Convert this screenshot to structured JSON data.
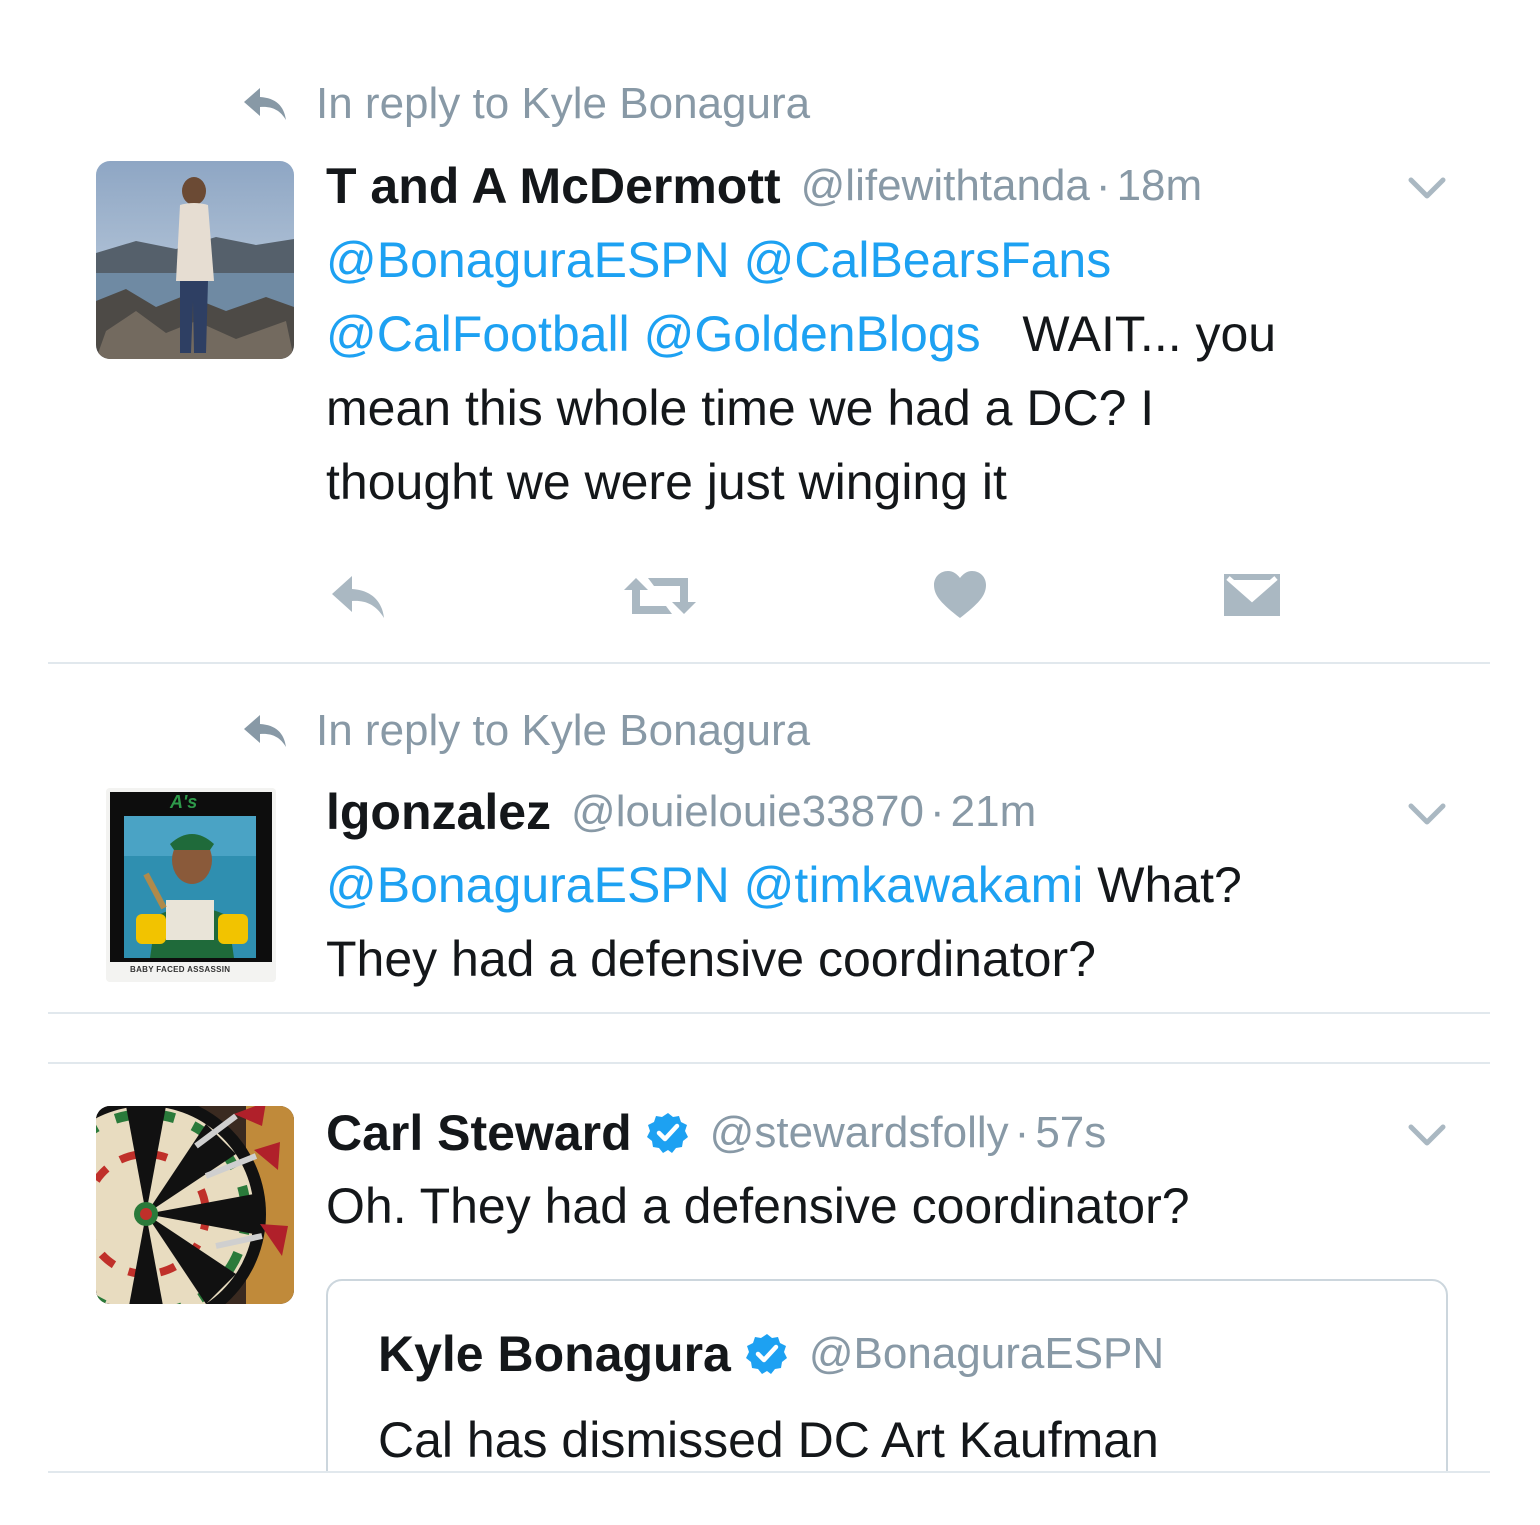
{
  "tweets": [
    {
      "reply_context": "In reply to Kyle Bonagura",
      "name": "T and A McDermott",
      "handle": "@lifewithtanda",
      "separator": "·",
      "time": "18m",
      "mentions": [
        "@BonaguraESPN",
        "@CalBearsFans",
        "@CalFootball",
        "@GoldenBlogs"
      ],
      "text_after_mentions": "WAIT... you",
      "text_lines": [
        "mean this whole time we had a DC? I",
        "thought we were just winging it"
      ]
    },
    {
      "reply_context": "In reply to Kyle Bonagura",
      "name": "lgonzalez",
      "handle": "@louielouie33870",
      "separator": "·",
      "time": "21m",
      "mentions": [
        "@BonaguraESPN",
        "@timkawakami"
      ],
      "text_after_mentions": "What?",
      "text_lines": [
        "They had a defensive coordinator?"
      ],
      "avatar_card": {
        "team_logo": "A's",
        "caption": "BABY FACED ASSASSIN"
      }
    },
    {
      "name": "Carl Steward",
      "verified": true,
      "handle": "@stewardsfolly",
      "separator": "·",
      "time": "57s",
      "text": "Oh. They had a defensive coordinator?",
      "quoted": {
        "name": "Kyle Bonagura",
        "verified": true,
        "handle": "@BonaguraESPN",
        "text": "Cal has dismissed DC Art Kaufman"
      }
    }
  ],
  "colors": {
    "mention": "#1da1f2",
    "meta": "#8899a6",
    "text": "#14171a",
    "icon": "#aab8c2",
    "divider": "#e1e8ed",
    "verified": "#1da1f2"
  },
  "icons": {
    "reply": "reply-icon",
    "retweet": "retweet-icon",
    "like": "heart-icon",
    "dm": "envelope-icon",
    "caret": "chevron-down-icon",
    "verified": "verified-badge-icon"
  }
}
